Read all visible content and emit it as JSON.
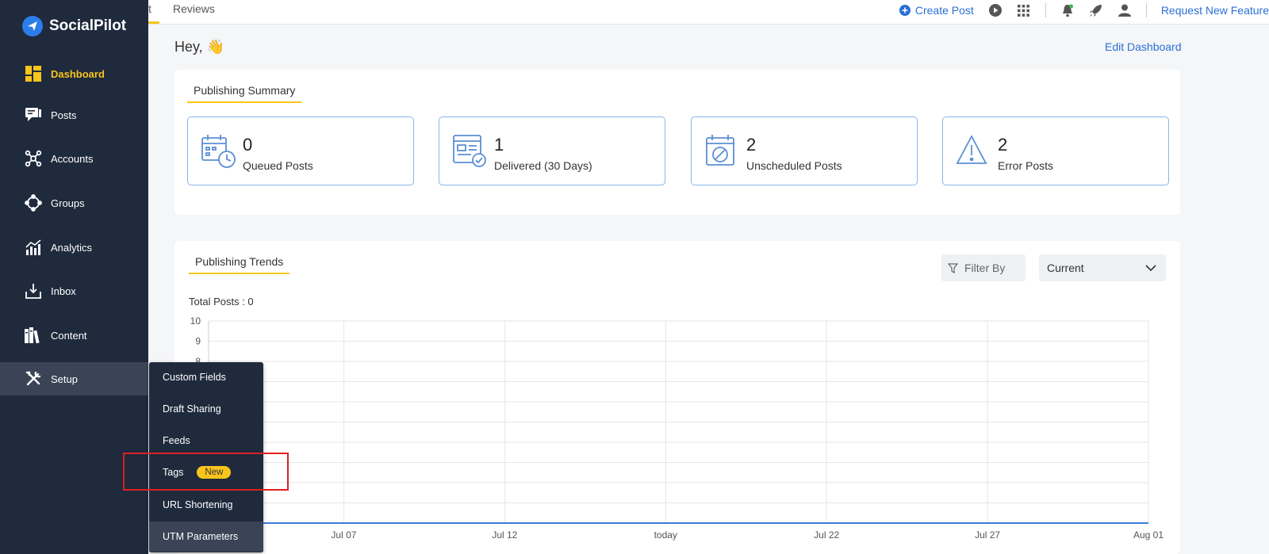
{
  "brand": {
    "name": "SocialPilot",
    "color": "#2b7de9"
  },
  "sidebar": {
    "items": [
      {
        "label": "Dashboard",
        "icon": "dashboard-icon",
        "active": true
      },
      {
        "label": "Posts",
        "icon": "posts-icon"
      },
      {
        "label": "Accounts",
        "icon": "accounts-icon"
      },
      {
        "label": "Groups",
        "icon": "groups-icon"
      },
      {
        "label": "Analytics",
        "icon": "analytics-icon"
      },
      {
        "label": "Inbox",
        "icon": "inbox-icon"
      },
      {
        "label": "Content",
        "icon": "content-icon"
      },
      {
        "label": "Setup",
        "icon": "setup-icon",
        "hovered": true
      }
    ]
  },
  "submenu": {
    "items": [
      {
        "label": "Custom Fields"
      },
      {
        "label": "Draft Sharing"
      },
      {
        "label": "Feeds"
      },
      {
        "label": "Tags",
        "badge": "New"
      },
      {
        "label": "URL Shortening"
      },
      {
        "label": "UTM Parameters"
      }
    ]
  },
  "topbar": {
    "tabs": [
      {
        "label": "t"
      },
      {
        "label": "Reviews"
      }
    ],
    "create_post": "Create Post",
    "request_feature": "Request New Feature",
    "icons": [
      "play-icon",
      "apps-grid-icon",
      "bell-icon",
      "rocket-icon",
      "user-icon"
    ]
  },
  "main": {
    "greeting": "Hey, 👋",
    "edit_dashboard": "Edit Dashboard",
    "summary": {
      "title": "Publishing Summary",
      "stats": [
        {
          "value": "0",
          "label": "Queued Posts",
          "icon": "calendar-clock-icon"
        },
        {
          "value": "1",
          "label": "Delivered (30 Days)",
          "icon": "delivered-icon"
        },
        {
          "value": "2",
          "label": "Unscheduled Posts",
          "icon": "calendar-blocked-icon"
        },
        {
          "value": "2",
          "label": "Error Posts",
          "icon": "warning-icon"
        }
      ]
    },
    "trends": {
      "title": "Publishing Trends",
      "filter_label": "Filter By",
      "period_selected": "Current",
      "total_posts": "Total Posts : 0"
    }
  },
  "chart_data": {
    "type": "line",
    "title": "",
    "xlabel": "",
    "ylabel": "",
    "ylim": [
      0,
      10
    ],
    "y_ticks": [
      "10",
      "9",
      "8"
    ],
    "x_ticks": [
      "Jul 07",
      "Jul 12",
      "today",
      "Jul 22",
      "Jul 27",
      "Aug 01"
    ],
    "series": [
      {
        "values": [
          0,
          0,
          0,
          0,
          0,
          0
        ]
      }
    ],
    "grid": true,
    "color": "#3b7dd8"
  }
}
